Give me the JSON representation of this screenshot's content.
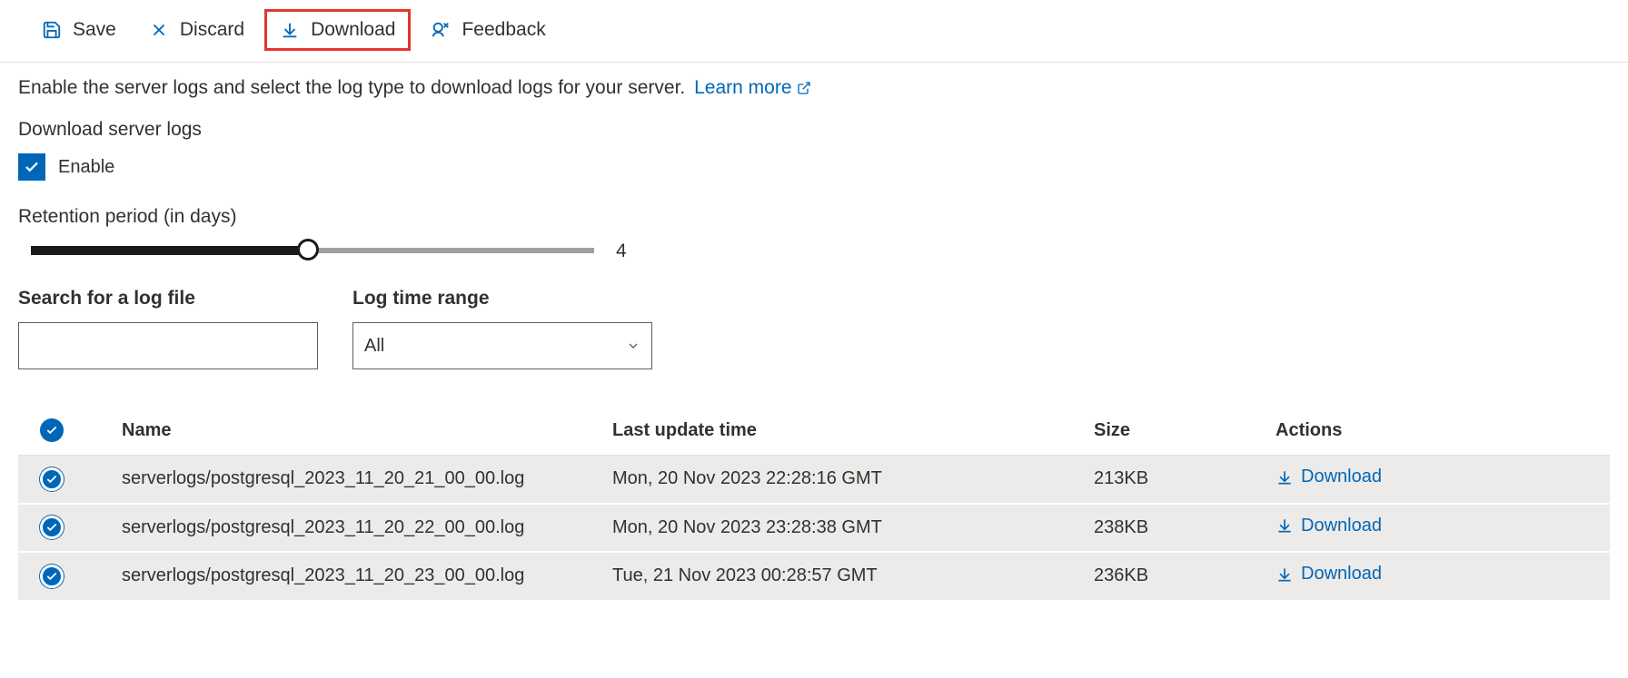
{
  "toolbar": {
    "save": "Save",
    "discard": "Discard",
    "download": "Download",
    "feedback": "Feedback"
  },
  "description": "Enable the server logs and select the log type to download logs for your server.",
  "learn_more": "Learn more",
  "download_logs_label": "Download server logs",
  "enable_label": "Enable",
  "retention_label": "Retention period (in days)",
  "retention_value": "4",
  "search_label": "Search for a log file",
  "timerange_label": "Log time range",
  "timerange_value": "All",
  "columns": {
    "name": "Name",
    "last_update": "Last update time",
    "size": "Size",
    "actions": "Actions"
  },
  "download_action": "Download",
  "rows": [
    {
      "name": "serverlogs/postgresql_2023_11_20_21_00_00.log",
      "updated": "Mon, 20 Nov 2023 22:28:16 GMT",
      "size": "213KB"
    },
    {
      "name": "serverlogs/postgresql_2023_11_20_22_00_00.log",
      "updated": "Mon, 20 Nov 2023 23:28:38 GMT",
      "size": "238KB"
    },
    {
      "name": "serverlogs/postgresql_2023_11_20_23_00_00.log",
      "updated": "Tue, 21 Nov 2023 00:28:57 GMT",
      "size": "236KB"
    }
  ]
}
